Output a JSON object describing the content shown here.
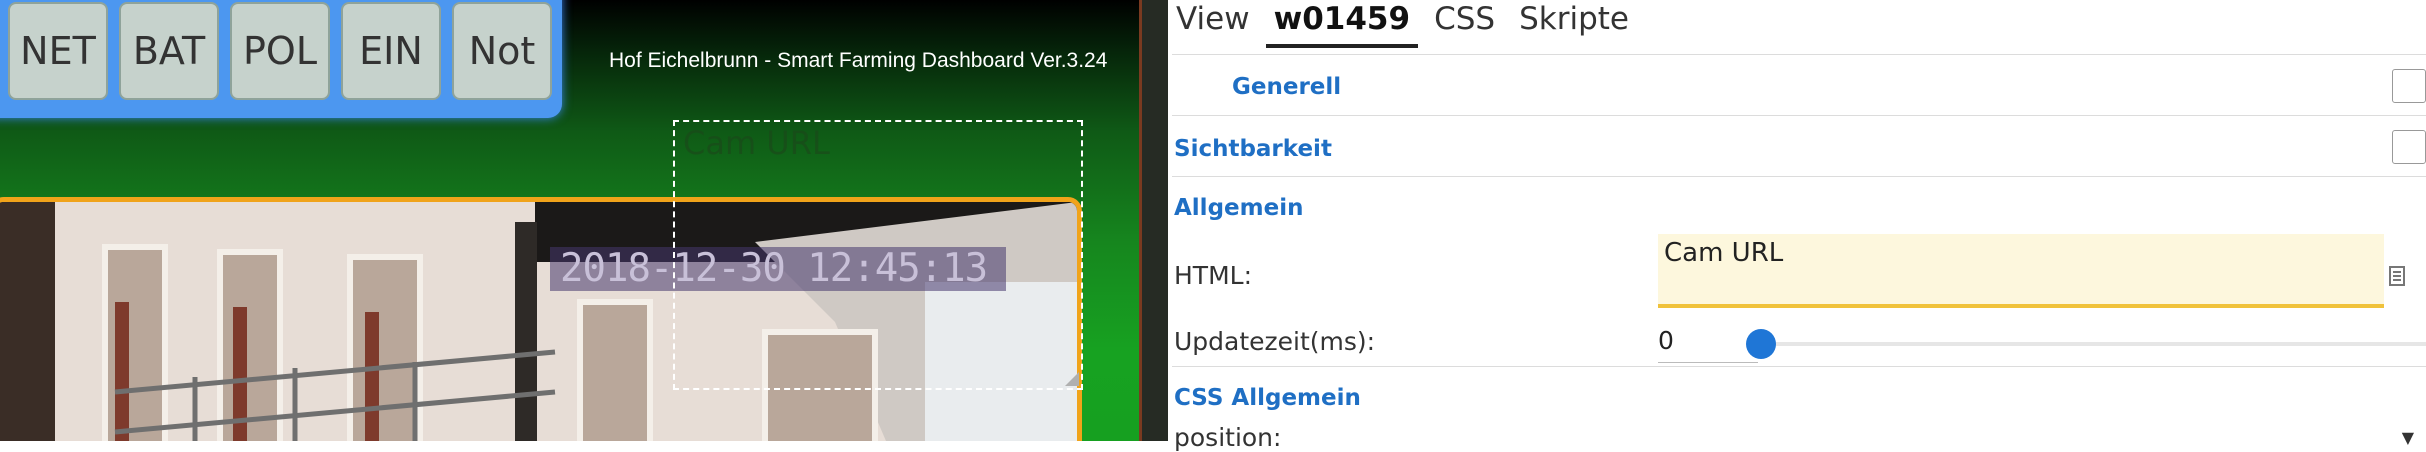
{
  "dashboard": {
    "nav_buttons": [
      "NET",
      "BAT",
      "POL",
      "EIN",
      "Not"
    ],
    "title": "Hof Eichelbrunn - Smart Farming Dashboard Ver.3.24",
    "camera": {
      "timestamp": "2018-12-30 12:45:13"
    },
    "selected_widget": {
      "label": "Cam URL"
    }
  },
  "panel": {
    "tabs": [
      "View",
      "w01459",
      "CSS",
      "Skripte"
    ],
    "active_tab": "w01459",
    "sections": {
      "generell": "Generell",
      "sichtbarkeit": "Sichtbarkeit",
      "allgemein": "Allgemein",
      "css_allgemein": "CSS Allgemein"
    },
    "fields": {
      "html_label": "HTML:",
      "html_value": "Cam URL",
      "update_label": "Updatezeit(ms):",
      "update_value": "0",
      "update_slider_fraction": 0,
      "position_label": "position:"
    }
  },
  "colors": {
    "accent_blue": "#1f6fc4",
    "button_bar_blue": "#4c97f0",
    "cam_frame_orange": "#f0a31a",
    "input_highlight": "#f0c23b"
  },
  "icons": [
    "edit-icon",
    "resize-handle-icon",
    "dropdown-caret-icon"
  ]
}
